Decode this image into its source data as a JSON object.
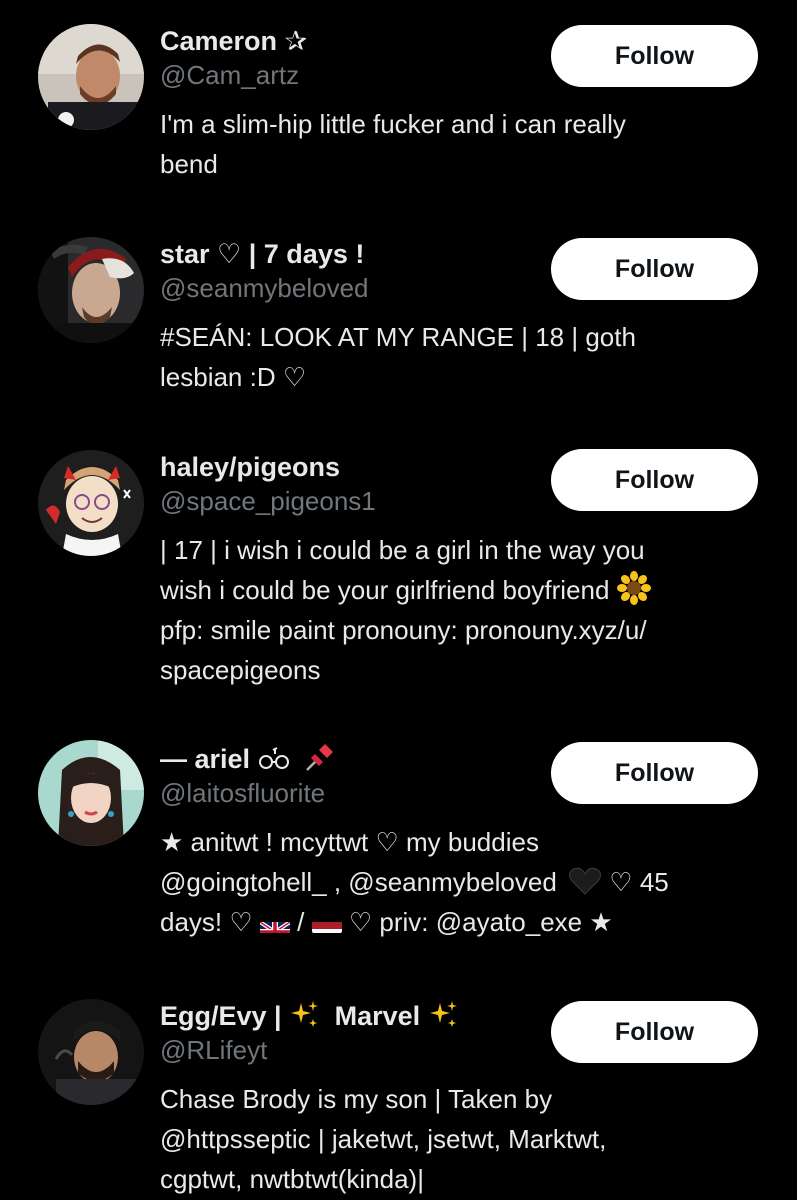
{
  "follow_label": "Follow",
  "users": [
    {
      "display_name": "Cameron ✰",
      "handle": "@Cam_artz",
      "bio_lines": [
        "I'm a slim-hip little fucker and i can really",
        "bend"
      ]
    },
    {
      "display_name": "star ♡ | 7 days !",
      "handle": "@seanmybeloved",
      "bio_lines": [
        "#SEÁN: LOOK AT MY RANGE | 18 | goth",
        "lesbian :D ♡"
      ]
    },
    {
      "display_name": "haley/pigeons",
      "handle": "@space_pigeons1",
      "bio_lines": [
        "| 17 | i wish i could be a girl in the way you",
        "wish i could be your girlfriend boyfriend",
        "pfp: smile paint pronouny: pronouny.xyz/u/",
        "spacepigeons"
      ],
      "bio_emoji": "sunflower-icon"
    },
    {
      "display_name": "— ariel ◌ ◌",
      "display_name_text": "— ariel",
      "name_symbols": "ꔛ",
      "handle": "@laitosfluorite",
      "bio_lines": [
        "★ anitwt ! mcyttwt ♡ my buddies",
        "@goingtohell_ , @seanmybeloved",
        "♡ 45",
        "days! ♡",
        "/",
        "♡ priv: @ayato_exe ★"
      ]
    },
    {
      "display_name": "Egg/Evy |",
      "display_name_mid": "Marvel",
      "handle": "@RLifeyt",
      "bio_lines": [
        "Chase Brody is my son | Taken by",
        "@httpsseptic | jaketwt, jsetwt, Marktwt,",
        "cgptwt, nwtbtwt(kinda)|"
      ]
    }
  ],
  "colors": {
    "background": "#000000",
    "text": "#e7e9ea",
    "secondary": "#71767b",
    "button_bg": "#ffffff",
    "button_text": "#0f1419"
  }
}
